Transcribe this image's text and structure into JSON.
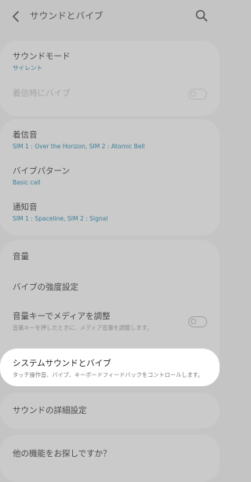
{
  "header": {
    "title": "サウンドとバイブ",
    "back_icon": "back-arrow-icon",
    "search_icon": "search-icon"
  },
  "sound_mode": {
    "label": "サウンドモード",
    "value": "サイレント"
  },
  "vibrate_on_ring": {
    "label": "着信時にバイブ",
    "enabled": false
  },
  "ringtone": {
    "label": "着信音",
    "value": "SIM 1 : Over the Horizon, SIM 2 : Atomic Bell"
  },
  "vibration_pattern": {
    "label": "バイブパターン",
    "value": "Basic call"
  },
  "notification_sound": {
    "label": "通知音",
    "value": "SIM 1 : Spaceline, SIM 2 : Signal"
  },
  "volume": {
    "label": "音量"
  },
  "vibration_intensity": {
    "label": "バイブの強度設定"
  },
  "volume_keys_for_media": {
    "label": "音量キーでメディアを調整",
    "description": "音量キーを押したときに、メディア音量を調整します。",
    "enabled": false
  },
  "system_sound_vibration": {
    "label": "システムサウンドとバイブ",
    "description": "タッチ操作音、バイブ、キーボードフィードバックをコントロールします。"
  },
  "advanced_sound_settings": {
    "label": "サウンドの詳細設定"
  },
  "looking_for_more": {
    "label": "他の機能をお探しですか？"
  },
  "colors": {
    "background": "#c4c4c4",
    "card": "#cacaca",
    "accent": "#3c7f98",
    "highlight": "#ffffff"
  }
}
